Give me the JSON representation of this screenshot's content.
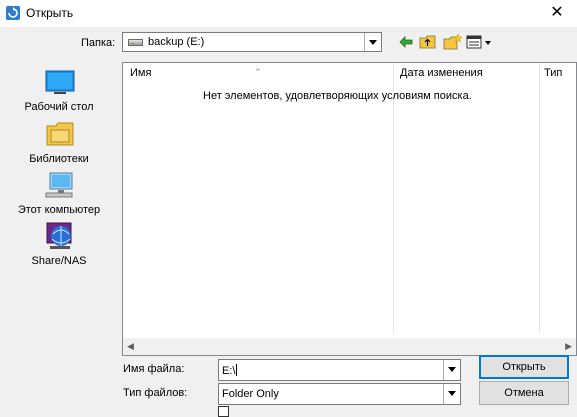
{
  "window": {
    "title": "Открыть",
    "close_glyph": "✕"
  },
  "lookin": {
    "label": "Папка:",
    "value": "backup (E:)"
  },
  "toolbar": {
    "back_icon": "back-arrow-icon",
    "up_icon": "folder-up-icon",
    "new_folder_icon": "new-folder-icon",
    "view_menu_icon": "view-menu-icon"
  },
  "places": [
    {
      "label": "Рабочий стол",
      "icon": "desktop-icon"
    },
    {
      "label": "Библиотеки",
      "icon": "libraries-icon"
    },
    {
      "label": "Этот компьютер",
      "icon": "computer-icon"
    },
    {
      "label": "Share/NAS",
      "icon": "network-share-icon"
    }
  ],
  "filelist": {
    "columns": [
      "Имя",
      "Дата изменения",
      "Тип"
    ],
    "empty_message": "Нет элементов, удовлетворяющих условиям поиска."
  },
  "filename": {
    "label": "Имя файла:",
    "value": "E:\\"
  },
  "filetype": {
    "label": "Тип файлов:",
    "value": "Folder Only"
  },
  "buttons": {
    "open": "Открыть",
    "cancel": "Отмена"
  },
  "colors": {
    "accent": "#0078d7",
    "window_bg": "#f0f0f0"
  }
}
